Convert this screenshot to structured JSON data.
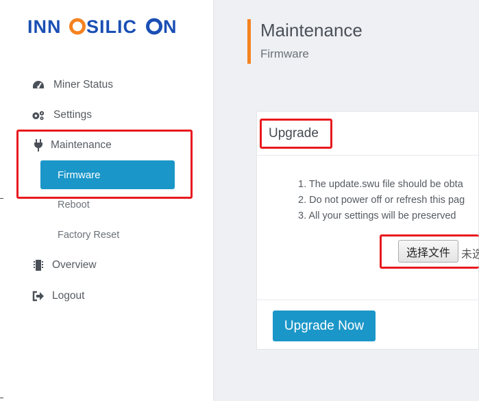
{
  "brand": {
    "logo_text": "INNOSILICON",
    "color_blue": "#1a4fb4",
    "color_orange": "#f5821f"
  },
  "sidebar": {
    "items": [
      {
        "label": "Miner Status",
        "icon": "dashboard-icon"
      },
      {
        "label": "Settings",
        "icon": "gears-icon"
      },
      {
        "label": "Maintenance",
        "icon": "plug-icon"
      },
      {
        "label": "Overview",
        "icon": "chip-icon"
      },
      {
        "label": "Logout",
        "icon": "sign-out-icon"
      }
    ],
    "maintenance_sub": [
      {
        "label": "Firmware",
        "active": true
      },
      {
        "label": "Reboot",
        "active": false
      },
      {
        "label": "Factory Reset",
        "active": false
      }
    ]
  },
  "header": {
    "title": "Maintenance",
    "subtitle": "Firmware"
  },
  "upgrade_card": {
    "title": "Upgrade",
    "notes": [
      "1. The update.swu file should be obta",
      "2. Do not power off or refresh this pag",
      "3. All your settings will be preserved"
    ],
    "file_button_label": "选择文件",
    "file_status": "未选",
    "submit_label": "Upgrade Now"
  },
  "colors": {
    "accent": "#1b96c8",
    "highlight": "#e8191e",
    "title_bar": "#f5821f"
  }
}
